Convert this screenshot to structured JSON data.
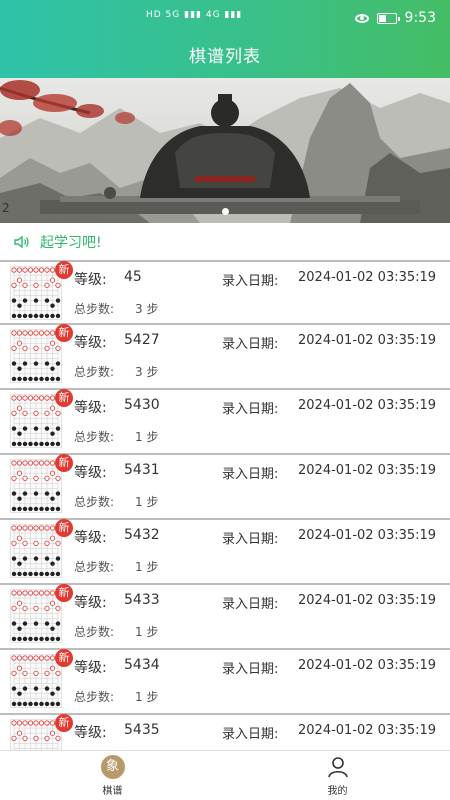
{
  "status_bar": {
    "network": "HD 5G ▮▮▮ 4G ▮▮▮",
    "time": "9:53"
  },
  "header": {
    "title": "棋谱列表"
  },
  "banner": {
    "index_label": "2",
    "active_dot": 1,
    "dot_count": 3
  },
  "notice": {
    "text": "起学习吧!"
  },
  "labels": {
    "level": "等级:",
    "date": "录入日期:",
    "steps": "总步数:",
    "new_badge": "新"
  },
  "records": [
    {
      "level": "45",
      "date": "2024-01-02 03:35:19",
      "steps": "3 步"
    },
    {
      "level": "5427",
      "date": "2024-01-02 03:35:19",
      "steps": "3 步"
    },
    {
      "level": "5430",
      "date": "2024-01-02 03:35:19",
      "steps": "1 步"
    },
    {
      "level": "5431",
      "date": "2024-01-02 03:35:19",
      "steps": "1 步"
    },
    {
      "level": "5432",
      "date": "2024-01-02 03:35:19",
      "steps": "1 步"
    },
    {
      "level": "5433",
      "date": "2024-01-02 03:35:19",
      "steps": "1 步"
    },
    {
      "level": "5434",
      "date": "2024-01-02 03:35:19",
      "steps": "1 步"
    },
    {
      "level": "5435",
      "date": "2024-01-02 03:35:19",
      "steps": ""
    }
  ],
  "tabbar": {
    "tabs": [
      {
        "label": "棋谱",
        "icon": "chess-piece-icon",
        "glyph": "象",
        "active": true
      },
      {
        "label": "我的",
        "icon": "user-icon",
        "active": false
      }
    ]
  },
  "colors": {
    "header_start": "#2fc2a9",
    "header_end": "#45bd65",
    "accent_green": "#2db86e",
    "badge_red": "#e5382f",
    "tab_active": "#b89a6a"
  }
}
